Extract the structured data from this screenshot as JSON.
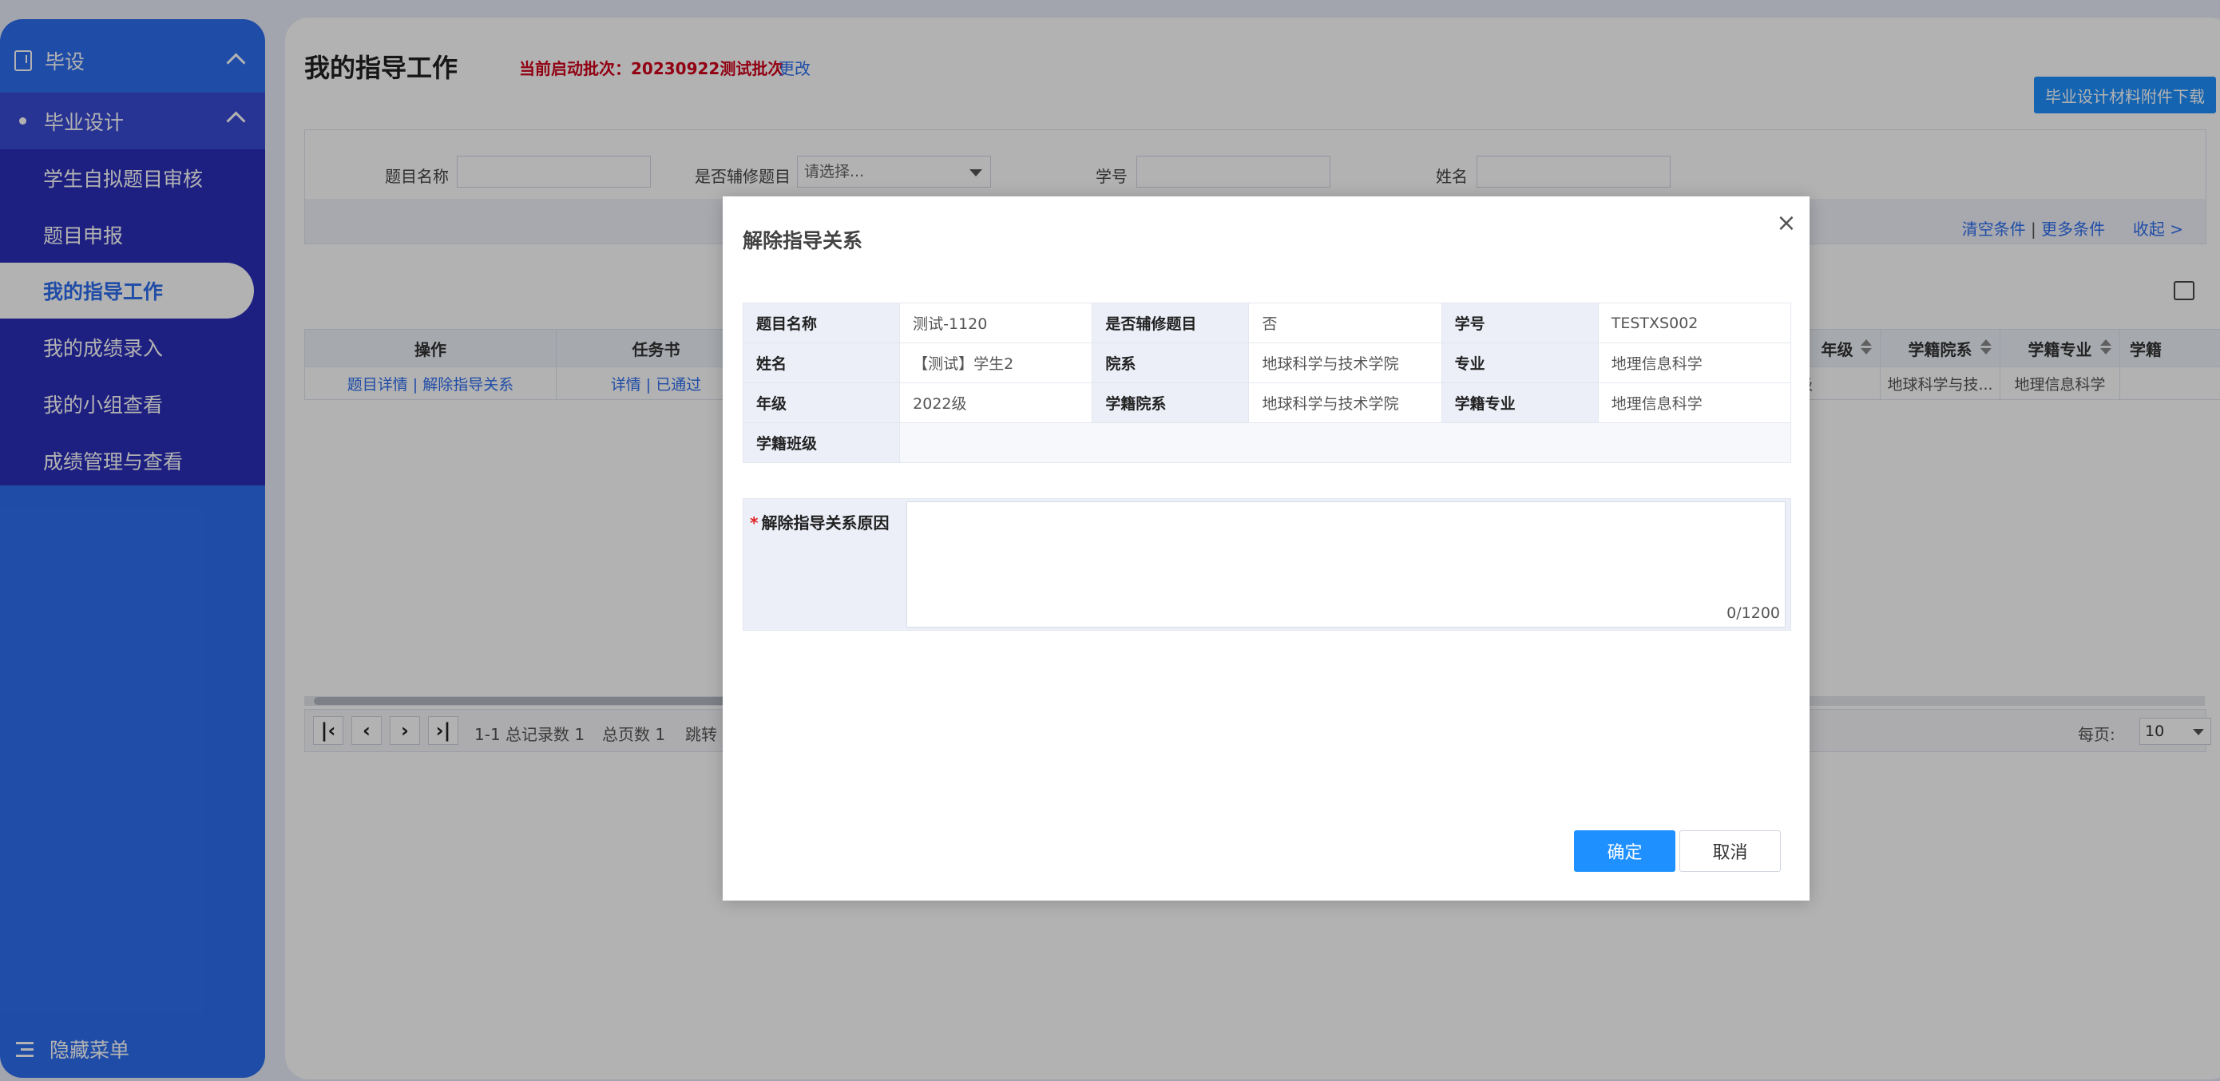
{
  "sidebar": {
    "top_label": "毕设",
    "section_label": "毕业设计",
    "items": [
      {
        "label": "学生自拟题目审核"
      },
      {
        "label": "题目申报"
      },
      {
        "label": "我的指导工作"
      },
      {
        "label": "我的成绩录入"
      },
      {
        "label": "我的小组查看"
      },
      {
        "label": "成绩管理与查看"
      }
    ],
    "active_index": 2,
    "hide_menu_label": "隐藏菜单"
  },
  "main": {
    "title": "我的指导工作",
    "batch_text": "当前启动批次：20230922测试批次",
    "change_link": "更改",
    "download_button": "毕业设计材料附件下载",
    "search": {
      "fields": [
        {
          "label": "题目名称",
          "value": ""
        },
        {
          "label": "是否辅修题目",
          "value": "请选择..."
        },
        {
          "label": "学号",
          "value": ""
        },
        {
          "label": "姓名",
          "value": ""
        }
      ],
      "clear_link": "清空条件",
      "separator": "|",
      "more_link": "更多条件",
      "collapse_link": "收起 >"
    },
    "table": {
      "left_headers": [
        "操作",
        "任务书"
      ],
      "right_headers": [
        "年级",
        "学籍院系",
        "学籍专业",
        "学籍"
      ],
      "row": {
        "actions": "题目详情 | 解除指导关系",
        "task": "详情 | 已通过",
        "grade": "级",
        "dept": "地球科学与技...",
        "major": "地理信息科学"
      }
    },
    "pager": {
      "record_text": "1-1 总记录数 1",
      "page_count_text": "总页数 1",
      "jump_text": "跳转",
      "per_page_label": "每页:",
      "per_page_value": "10"
    }
  },
  "modal": {
    "title": "解除指导关系",
    "close": "×",
    "rows": [
      [
        {
          "k": "题目名称",
          "v": "测试-1120"
        },
        {
          "k": "是否辅修题目",
          "v": "否"
        },
        {
          "k": "学号",
          "v": "TESTXS002"
        }
      ],
      [
        {
          "k": "姓名",
          "v": "【测试】学生2"
        },
        {
          "k": "院系",
          "v": "地球科学与技术学院"
        },
        {
          "k": "专业",
          "v": "地理信息科学"
        }
      ],
      [
        {
          "k": "年级",
          "v": "2022级"
        },
        {
          "k": "学籍院系",
          "v": "地球科学与技术学院"
        },
        {
          "k": "学籍专业",
          "v": "地理信息科学"
        }
      ],
      [
        {
          "k": "学籍班级",
          "v": ""
        }
      ]
    ],
    "reason_required_mark": "*",
    "reason_label": "解除指导关系原因",
    "reason_value": "",
    "char_count": "0/1200",
    "confirm_button": "确定",
    "cancel_button": "取消"
  },
  "colors": {
    "sidebar_blue": "#2d6ef0",
    "submenu_indigo": "#2a2fb9",
    "primary_button": "#1e90ff",
    "batch_red": "#d0021b"
  }
}
